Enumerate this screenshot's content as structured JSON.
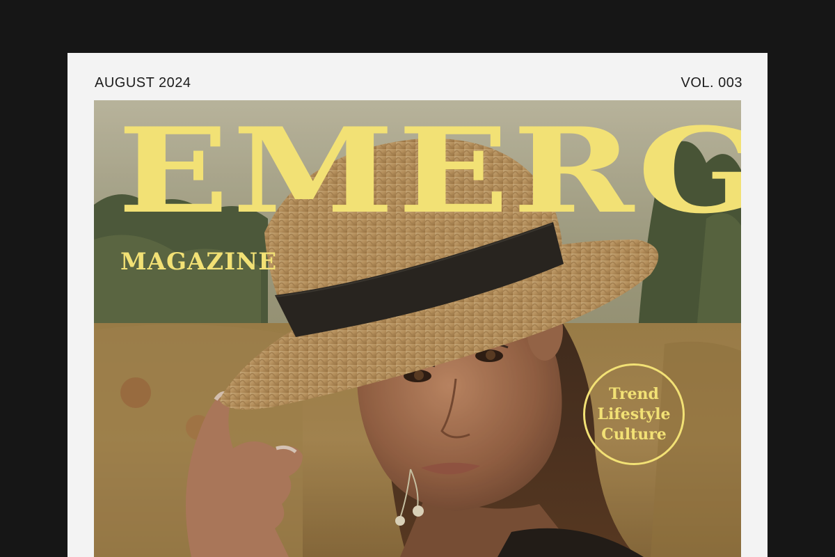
{
  "header": {
    "issue_date": "AUGUST 2024",
    "volume": "VOL. 003"
  },
  "cover": {
    "title": "EMERGE",
    "subtitle": "MAGAZINE",
    "seal_lines": [
      "Trend",
      "Lifestyle",
      "Culture"
    ],
    "photo_icon": "portrait-photo"
  },
  "colors": {
    "background": "#161616",
    "sheet": "#f3f3f3",
    "accent": "#f2e175",
    "text": "#1c1c1c"
  }
}
